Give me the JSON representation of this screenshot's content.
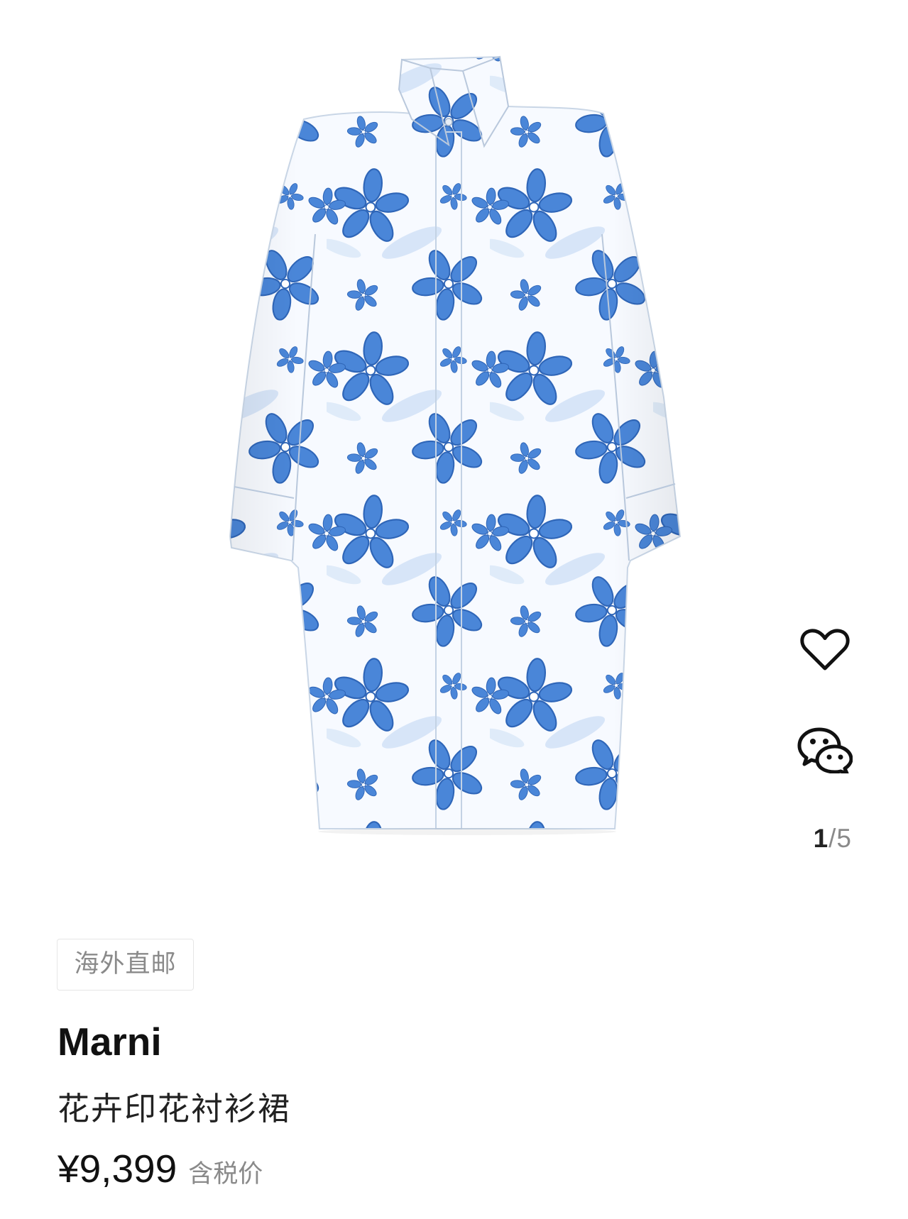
{
  "gallery": {
    "current": "1",
    "separator": "/",
    "total": "5"
  },
  "actions": {
    "favorite_icon": "heart-icon",
    "share_icon": "wechat-icon"
  },
  "product": {
    "tag": "海外直邮",
    "brand": "Marni",
    "title": "花卉印花衬衫裙",
    "price": "¥9,399",
    "price_note": "含税价"
  },
  "colors": {
    "print_blue": "#4a86d8",
    "print_outline": "#2f66b8",
    "text": "#111111",
    "muted": "#8a8a8a",
    "tag_border": "#e6e6e6"
  }
}
